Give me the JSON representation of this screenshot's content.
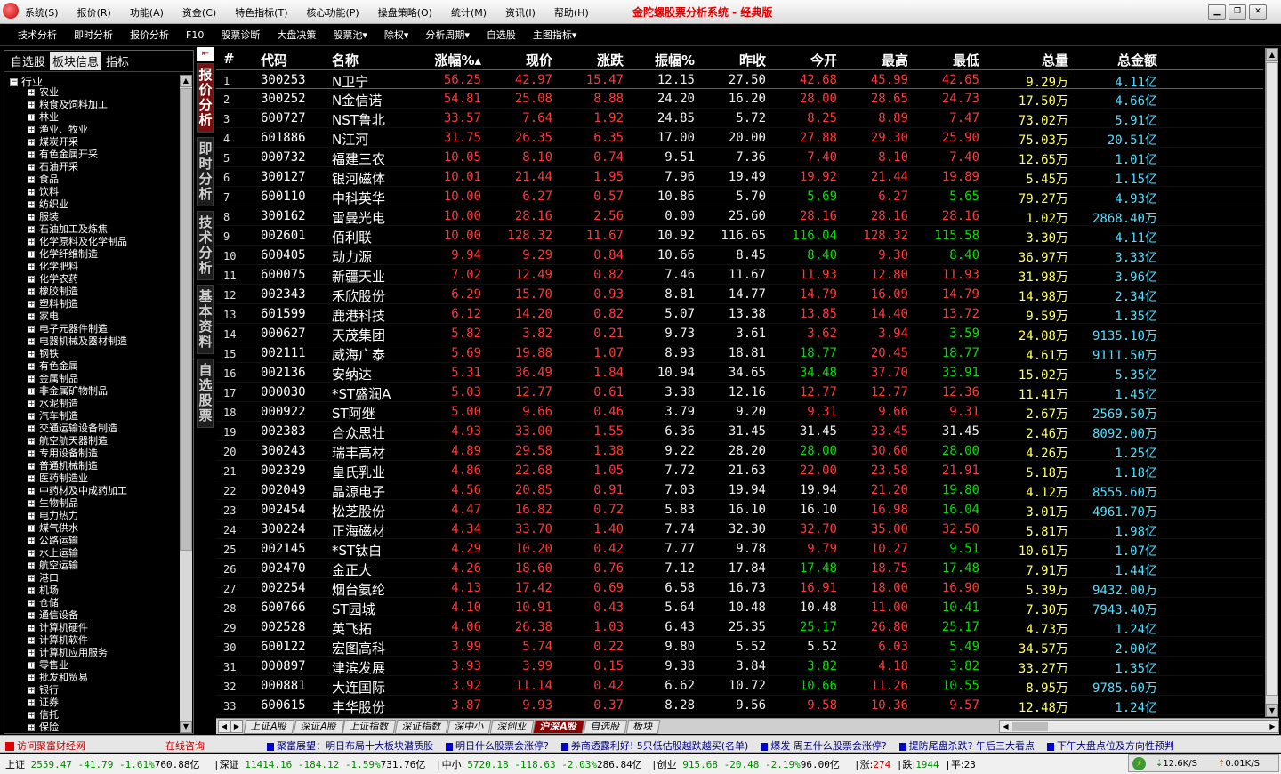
{
  "titlebar": {
    "menus": [
      "系统(S)",
      "报价(R)",
      "功能(A)",
      "资金(C)",
      "特色指标(T)",
      "核心功能(P)",
      "操盘策略(O)",
      "统计(M)",
      "资讯(I)",
      "帮助(H)"
    ],
    "title": "金陀螺股票分析系统 - 经典版"
  },
  "toolbar": {
    "items": [
      "技术分析",
      "即时分析",
      "报价分析",
      "F10",
      "股票诊断",
      "大盘决策",
      "股票池▾",
      "除权▾",
      "分析周期▾",
      "自选股",
      "主图指标▾"
    ]
  },
  "leftpanel": {
    "tabs": [
      "自选股",
      "板块信息",
      "指标"
    ],
    "root": "行业",
    "items": [
      "农业",
      "粮食及饲料加工",
      "林业",
      "渔业、牧业",
      "煤炭开采",
      "有色金属开采",
      "石油开采",
      "食品",
      "饮料",
      "纺织业",
      "服装",
      "石油加工及炼焦",
      "化学原料及化学制品",
      "化学纤维制造",
      "化学肥料",
      "化学农药",
      "橡胶制造",
      "塑料制造",
      "家电",
      "电子元器件制造",
      "电器机械及器材制造",
      "钢铁",
      "有色金属",
      "金属制品",
      "非金属矿物制品",
      "水泥制造",
      "汽车制造",
      "交通运输设备制造",
      "航空航天器制造",
      "专用设备制造",
      "普通机械制造",
      "医药制造业",
      "中药材及中成药加工",
      "生物制品",
      "电力热力",
      "煤气供水",
      "公路运输",
      "水上运输",
      "航空运输",
      "港口",
      "机场",
      "仓储",
      "通信设备",
      "计算机硬件",
      "计算机软件",
      "计算机应用服务",
      "零售业",
      "批发和贸易",
      "银行",
      "证券",
      "信托",
      "保险"
    ]
  },
  "vtabs": [
    "报价分析",
    "即时分析",
    "技术分析",
    "基本资料",
    "自选股票"
  ],
  "grid": {
    "headers": [
      "#",
      "代码",
      "名称",
      "涨幅%▴",
      "现价",
      "涨跌",
      "振幅%",
      "昨收",
      "今开",
      "最高",
      "最低",
      "总量",
      "总金额"
    ],
    "rows": [
      [
        "1",
        "300253",
        "N卫宁",
        "56.25",
        "42.97",
        "15.47",
        "12.15",
        "27.50",
        "42.68",
        "45.99",
        "42.65",
        "9.29万",
        "4.11亿"
      ],
      [
        "2",
        "300252",
        "N金信诺",
        "54.81",
        "25.08",
        "8.88",
        "24.20",
        "16.20",
        "28.00",
        "28.65",
        "24.73",
        "17.50万",
        "4.66亿"
      ],
      [
        "3",
        "600727",
        "NST鲁北",
        "33.57",
        "7.64",
        "1.92",
        "24.85",
        "5.72",
        "8.25",
        "8.89",
        "7.47",
        "73.02万",
        "5.91亿"
      ],
      [
        "4",
        "601886",
        "N江河",
        "31.75",
        "26.35",
        "6.35",
        "17.00",
        "20.00",
        "27.88",
        "29.30",
        "25.90",
        "75.03万",
        "20.51亿"
      ],
      [
        "5",
        "000732",
        "福建三农",
        "10.05",
        "8.10",
        "0.74",
        "9.51",
        "7.36",
        "7.40",
        "8.10",
        "7.40",
        "12.65万",
        "1.01亿"
      ],
      [
        "6",
        "300127",
        "银河磁体",
        "10.01",
        "21.44",
        "1.95",
        "7.96",
        "19.49",
        "19.92",
        "21.44",
        "19.89",
        "5.45万",
        "1.15亿"
      ],
      [
        "7",
        "600110",
        "中科英华",
        "10.00",
        "6.27",
        "0.57",
        "10.86",
        "5.70",
        "5.69",
        "6.27",
        "5.65",
        "79.27万",
        "4.93亿"
      ],
      [
        "8",
        "300162",
        "雷曼光电",
        "10.00",
        "28.16",
        "2.56",
        "0.00",
        "25.60",
        "28.16",
        "28.16",
        "28.16",
        "1.02万",
        "2868.40万"
      ],
      [
        "9",
        "002601",
        "佰利联",
        "10.00",
        "128.32",
        "11.67",
        "10.92",
        "116.65",
        "116.04",
        "128.32",
        "115.58",
        "3.30万",
        "4.11亿"
      ],
      [
        "10",
        "600405",
        "动力源",
        "9.94",
        "9.29",
        "0.84",
        "10.66",
        "8.45",
        "8.40",
        "9.30",
        "8.40",
        "36.97万",
        "3.33亿"
      ],
      [
        "11",
        "600075",
        "新疆天业",
        "7.02",
        "12.49",
        "0.82",
        "7.46",
        "11.67",
        "11.93",
        "12.80",
        "11.93",
        "31.98万",
        "3.96亿"
      ],
      [
        "12",
        "002343",
        "禾欣股份",
        "6.29",
        "15.70",
        "0.93",
        "8.81",
        "14.77",
        "14.79",
        "16.09",
        "14.79",
        "14.98万",
        "2.34亿"
      ],
      [
        "13",
        "601599",
        "鹿港科技",
        "6.12",
        "14.20",
        "0.82",
        "5.07",
        "13.38",
        "13.85",
        "14.40",
        "13.72",
        "9.59万",
        "1.35亿"
      ],
      [
        "14",
        "000627",
        "天茂集团",
        "5.82",
        "3.82",
        "0.21",
        "9.73",
        "3.61",
        "3.62",
        "3.94",
        "3.59",
        "24.08万",
        "9135.10万"
      ],
      [
        "15",
        "002111",
        "威海广泰",
        "5.69",
        "19.88",
        "1.07",
        "8.93",
        "18.81",
        "18.77",
        "20.45",
        "18.77",
        "4.61万",
        "9111.50万"
      ],
      [
        "16",
        "002136",
        "安纳达",
        "5.31",
        "36.49",
        "1.84",
        "10.94",
        "34.65",
        "34.48",
        "37.70",
        "33.91",
        "15.02万",
        "5.35亿"
      ],
      [
        "17",
        "000030",
        "*ST盛润A",
        "5.03",
        "12.77",
        "0.61",
        "3.38",
        "12.16",
        "12.77",
        "12.77",
        "12.36",
        "11.41万",
        "1.45亿"
      ],
      [
        "18",
        "000922",
        "ST阿继",
        "5.00",
        "9.66",
        "0.46",
        "3.79",
        "9.20",
        "9.31",
        "9.66",
        "9.31",
        "2.67万",
        "2569.50万"
      ],
      [
        "19",
        "002383",
        "合众思壮",
        "4.93",
        "33.00",
        "1.55",
        "6.36",
        "31.45",
        "31.45",
        "33.45",
        "31.45",
        "2.46万",
        "8092.00万"
      ],
      [
        "20",
        "300243",
        "瑞丰高材",
        "4.89",
        "29.58",
        "1.38",
        "9.22",
        "28.20",
        "28.00",
        "30.60",
        "28.00",
        "4.26万",
        "1.25亿"
      ],
      [
        "21",
        "002329",
        "皇氏乳业",
        "4.86",
        "22.68",
        "1.05",
        "7.72",
        "21.63",
        "22.00",
        "23.58",
        "21.91",
        "5.18万",
        "1.18亿"
      ],
      [
        "22",
        "002049",
        "晶源电子",
        "4.56",
        "20.85",
        "0.91",
        "7.03",
        "19.94",
        "19.94",
        "21.20",
        "19.80",
        "4.12万",
        "8555.60万"
      ],
      [
        "23",
        "002454",
        "松芝股份",
        "4.47",
        "16.82",
        "0.72",
        "5.83",
        "16.10",
        "16.10",
        "16.98",
        "16.04",
        "3.01万",
        "4961.70万"
      ],
      [
        "24",
        "300224",
        "正海磁材",
        "4.34",
        "33.70",
        "1.40",
        "7.74",
        "32.30",
        "32.70",
        "35.00",
        "32.50",
        "5.81万",
        "1.98亿"
      ],
      [
        "25",
        "002145",
        "*ST钛白",
        "4.29",
        "10.20",
        "0.42",
        "7.77",
        "9.78",
        "9.79",
        "10.27",
        "9.51",
        "10.61万",
        "1.07亿"
      ],
      [
        "26",
        "002470",
        "金正大",
        "4.26",
        "18.60",
        "0.76",
        "7.12",
        "17.84",
        "17.48",
        "18.75",
        "17.48",
        "7.91万",
        "1.44亿"
      ],
      [
        "27",
        "002254",
        "烟台氨纶",
        "4.13",
        "17.42",
        "0.69",
        "6.58",
        "16.73",
        "16.91",
        "18.00",
        "16.90",
        "5.39万",
        "9432.00万"
      ],
      [
        "28",
        "600766",
        "ST园城",
        "4.10",
        "10.91",
        "0.43",
        "5.64",
        "10.48",
        "10.48",
        "11.00",
        "10.41",
        "7.30万",
        "7943.40万"
      ],
      [
        "29",
        "002528",
        "英飞拓",
        "4.06",
        "26.38",
        "1.03",
        "6.43",
        "25.35",
        "25.17",
        "26.80",
        "25.17",
        "4.73万",
        "1.24亿"
      ],
      [
        "30",
        "600122",
        "宏图高科",
        "3.99",
        "5.74",
        "0.22",
        "9.80",
        "5.52",
        "5.52",
        "6.03",
        "5.49",
        "34.57万",
        "2.00亿"
      ],
      [
        "31",
        "000897",
        "津滨发展",
        "3.93",
        "3.99",
        "0.15",
        "9.38",
        "3.84",
        "3.82",
        "4.18",
        "3.82",
        "33.27万",
        "1.35亿"
      ],
      [
        "32",
        "000881",
        "大连国际",
        "3.92",
        "11.14",
        "0.42",
        "6.62",
        "10.72",
        "10.66",
        "11.26",
        "10.55",
        "8.95万",
        "9785.60万"
      ],
      [
        "33",
        "600615",
        "丰华股份",
        "3.87",
        "9.93",
        "0.37",
        "8.28",
        "9.56",
        "9.58",
        "10.36",
        "9.57",
        "12.48万",
        "1.24亿"
      ]
    ]
  },
  "sheettabs": [
    "上证A股",
    "深证A股",
    "上证指数",
    "深证指数",
    "深中小",
    "深创业",
    "沪深A股",
    "自选股",
    "板块"
  ],
  "newsbar": {
    "left": "访问聚富财经网",
    "consult": "在线咨询",
    "items": [
      "聚富展望：明日布局十大板块潜质股",
      "明日什么股票会涨停?",
      "券商透露利好! 5只低估股越跌越买(名单)",
      "爆发 周五什么股票会涨停?",
      "提防尾盘杀跌? 午后三大看点",
      "下午大盘点位及方向性预判"
    ]
  },
  "status": {
    "sh": {
      "label": "上证",
      "idx": "2559.47",
      "chg": "-41.79",
      "pct": "-1.61%",
      "amt": "760.88亿"
    },
    "sz": {
      "label": "深证",
      "idx": "11414.16",
      "chg": "-184.12",
      "pct": "-1.59%",
      "amt": "731.76亿"
    },
    "zx": {
      "label": "中小",
      "idx": "5720.18",
      "chg": "-118.63",
      "pct": "-2.03%",
      "amt": "286.84亿"
    },
    "cy": {
      "label": "创业",
      "idx": "915.68",
      "chg": "-20.48",
      "pct": "-2.19%",
      "amt": "96.00亿"
    },
    "up_label": "涨:",
    "up": "274",
    "down_label": "跌:",
    "down": "1944",
    "flat_label": "平:",
    "flat": "23",
    "net_down": "12.6K/S",
    "net_up": "0.01K/S"
  },
  "colors": {
    "up": "#ff3838",
    "down": "#00e000",
    "volume": "#ffff66",
    "amount": "#55ddff"
  }
}
